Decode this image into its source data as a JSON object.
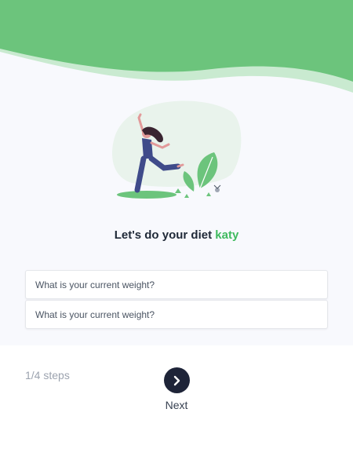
{
  "headline": {
    "prefix": "Let's do your diet",
    "name": "katy"
  },
  "form": {
    "field_1_placeholder": "What is your current weight?",
    "field_2_placeholder": "What is your current weight?"
  },
  "footer": {
    "steps_text": "1/4 steps",
    "next_label": "Next"
  },
  "icons": {
    "next": "chevron-right-icon"
  },
  "colors": {
    "brand_green": "#6cc47c",
    "accent_green": "#3fba5e",
    "button_dark": "#1e2438",
    "background": "#f8f9fd"
  }
}
